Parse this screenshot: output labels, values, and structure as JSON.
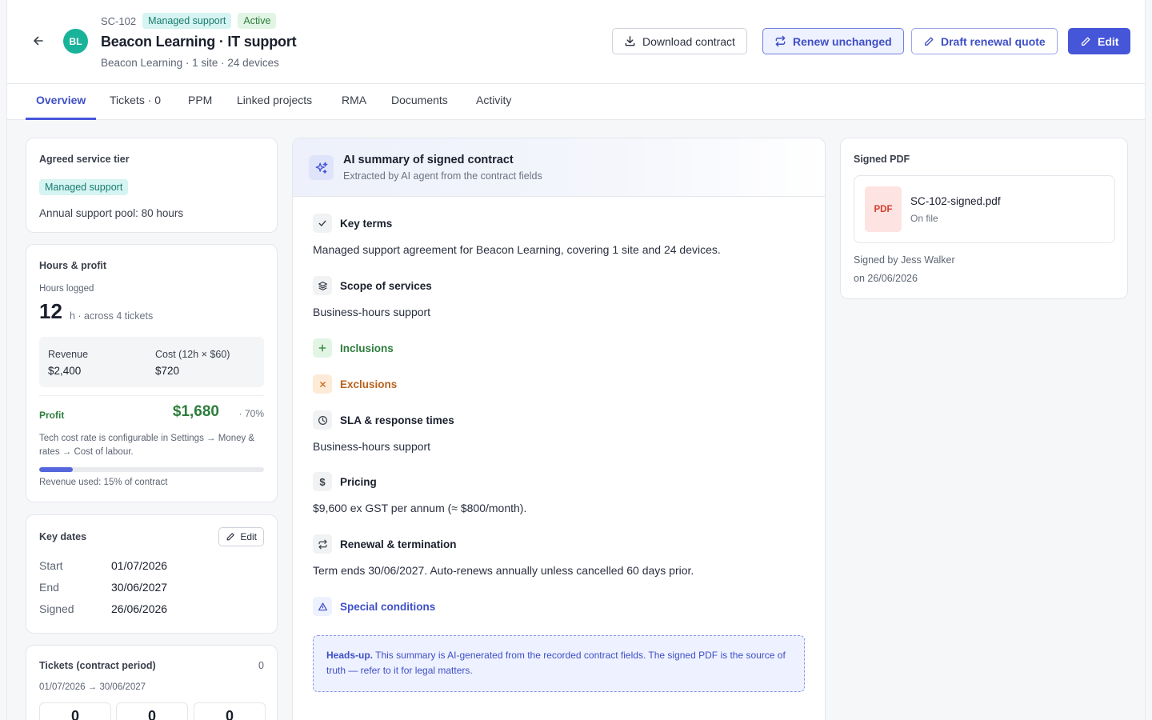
{
  "header": {
    "back_icon": "arrow-left-icon",
    "avatar_initials": "BL",
    "code": "SC-102",
    "badges": [
      "Managed support",
      "Active"
    ],
    "title": "Beacon Learning · IT support",
    "subtitle": "Beacon Learning · 1 site · 24 devices",
    "actions": {
      "download": "Download contract",
      "renew": "Renew unchanged",
      "draft": "Draft renewal quote",
      "edit": "Edit"
    },
    "colors": {
      "accent": "#4656d8",
      "avatar": "#19b39a"
    }
  },
  "tabs": [
    "Overview",
    "Tickets · 0",
    "PPM",
    "Linked projects",
    "RMA",
    "Documents",
    "Activity"
  ],
  "tier": {
    "title": "Agreed service tier",
    "badge": "Managed support",
    "pool": "Annual support pool: 80 hours"
  },
  "hours": {
    "title": "Hours & profit",
    "logged_label": "Hours logged",
    "logged_value": "12",
    "logged_unit": "h · across 4 tickets",
    "revenue_label": "Revenue",
    "revenue_value": "$2,400",
    "cost_label": "Cost (12h × $60)",
    "cost_value": "$720",
    "profit_label": "Profit",
    "profit_value": "$1,680",
    "profit_pct": "· 70%",
    "tech_note": "Tech cost rate is configurable in Settings → Money & rates → Cost of labour.",
    "revenue_used_fraction": 0.15,
    "revenue_used_text": "Revenue used: 15% of contract"
  },
  "dates": {
    "title": "Key dates",
    "edit_label": "Edit",
    "rows": [
      {
        "key": "Start",
        "value": "01/07/2026"
      },
      {
        "key": "End",
        "value": "30/06/2027"
      },
      {
        "key": "Signed",
        "value": "26/06/2026"
      }
    ]
  },
  "tickets": {
    "title": "Tickets (contract period)",
    "count": "0",
    "period": "01/07/2026 → 30/06/2027",
    "stats": [
      "0",
      "0",
      "0"
    ]
  },
  "ai": {
    "icon": "sparkles-icon",
    "title": "AI summary of signed contract",
    "subtitle": "Extracted by AI agent from the contract fields",
    "sections": {
      "key_terms": {
        "label": "Key terms",
        "icon": "check-icon",
        "text": "Managed support agreement for Beacon Learning, covering 1 site and 24 devices."
      },
      "scope": {
        "label": "Scope of services",
        "icon": "layers-icon",
        "text": "Business-hours support"
      },
      "inclusions": {
        "label": "Inclusions",
        "icon": "plus-icon"
      },
      "exclusions": {
        "label": "Exclusions",
        "icon": "x-icon"
      },
      "sla": {
        "label": "SLA & response times",
        "icon": "clock-icon",
        "text": "Business-hours support"
      },
      "pricing": {
        "label": "Pricing",
        "icon": "dollar-icon",
        "text": "$9,600 ex GST per annum (≈ $800/month)."
      },
      "renewal": {
        "label": "Renewal & termination",
        "icon": "repeat-icon",
        "text": "Term ends 30/06/2027. Auto-renews annually unless cancelled 60 days prior."
      },
      "special": {
        "label": "Special conditions",
        "icon": "warning-icon"
      }
    },
    "headsup_bold": "Heads-up.",
    "headsup_text": "This summary is AI-generated from the recorded contract fields. The signed PDF is the source of truth — refer to it for legal matters."
  },
  "pdf": {
    "title": "Signed PDF",
    "badge": "PDF",
    "filename": "SC-102-signed.pdf",
    "status": "On file",
    "signed_by": "Signed by Jess Walker",
    "signed_on": "on 26/06/2026"
  }
}
